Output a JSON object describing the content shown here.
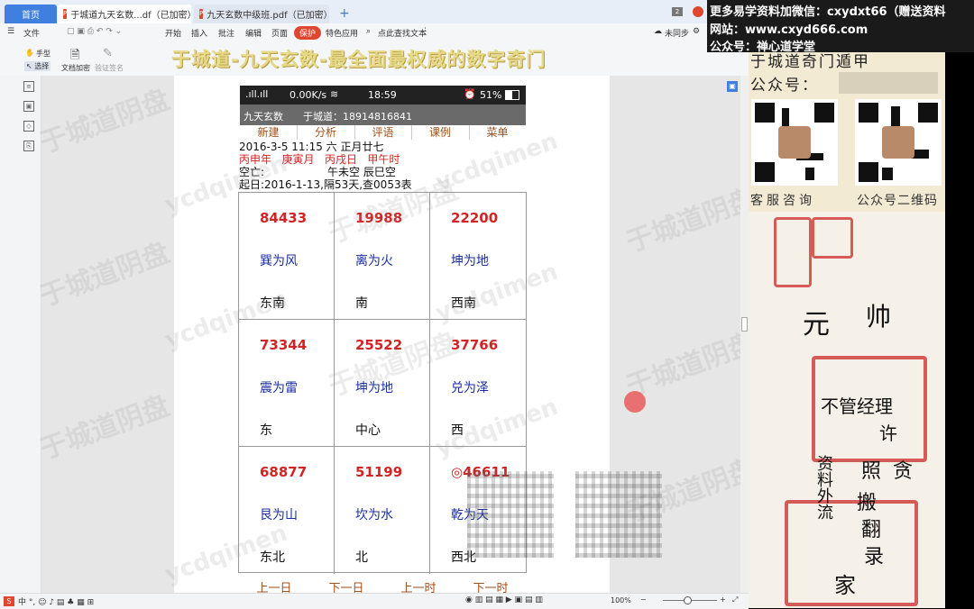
{
  "tabs": [
    {
      "label": "首页"
    },
    {
      "label": "于城道九天玄数...df（已加密）"
    },
    {
      "label": "九天玄数中级班.pdf（已加密）"
    }
  ],
  "toolbar": {
    "file": "文件",
    "items": [
      "开始",
      "插入",
      "批注",
      "编辑",
      "页面",
      "保护",
      "特色应用"
    ],
    "search_placeholder": "点此查找文本",
    "sync": "未同步"
  },
  "toolbar2": {
    "hand": "手型",
    "select": "选择",
    "encrypt": "文档加密",
    "verify": "验证签名"
  },
  "banner": "于城道-九天玄数-最全面最权威的数字奇门",
  "ad": {
    "line1": "更多易学资料加微信：cxydxt66（赠送资料",
    "line2": "网站：www.cxyd666.com",
    "line3": "公众号：禅心道学堂"
  },
  "right_panel": {
    "header": "于城道奇门遁甲",
    "subheader": "公众号：",
    "qr_label_left": "客服咨询",
    "qr_label_right": "公众号二维码"
  },
  "phone": {
    "signal": ".ıll.ıll",
    "speed": "0.00K/s",
    "time": "18:59",
    "battery": "51%",
    "app_name": "九天玄数",
    "app_author": "于城道：18914816841",
    "menu": [
      "新建",
      "分析",
      "评语",
      "课例",
      "菜单"
    ],
    "date_line": "2016-3-5 11:15 六 正月廿七",
    "ganzhi": [
      "丙申年",
      "庚寅月",
      "丙戌日",
      "甲午时"
    ],
    "kongwang_label": "空亡:",
    "kongwang_values": "午未空  辰巳空",
    "start_line": "起日:2016-1-13,隔53天,查0053表",
    "cells": [
      {
        "num": "84433",
        "name": "巽为风",
        "dir": "东南"
      },
      {
        "num": "19988",
        "name": "离为火",
        "dir": "南"
      },
      {
        "num": "22200",
        "name": "坤为地",
        "dir": "西南"
      },
      {
        "num": "73344",
        "name": "震为雷",
        "dir": "东"
      },
      {
        "num": "25522",
        "name": "坤为地",
        "dir": "中心"
      },
      {
        "num": "37766",
        "name": "兑为泽",
        "dir": "西"
      },
      {
        "num": "68877",
        "name": "艮为山",
        "dir": "东北"
      },
      {
        "num": "51199",
        "name": "坎为水",
        "dir": "北"
      },
      {
        "num": "◎46611",
        "name": "乾为天",
        "dir": "西北"
      }
    ],
    "nav": [
      "上一日",
      "下一日",
      "上一时",
      "下一时"
    ]
  },
  "watermark": "于城道阴盘",
  "watermark2": "ycdqimen",
  "statusbar": {
    "zoom": "100%"
  },
  "handwriting": [
    "元",
    "帅",
    "经理",
    "不管",
    "许",
    "照",
    "贪",
    "资料外流",
    "搬",
    "翻",
    "录",
    "家"
  ]
}
